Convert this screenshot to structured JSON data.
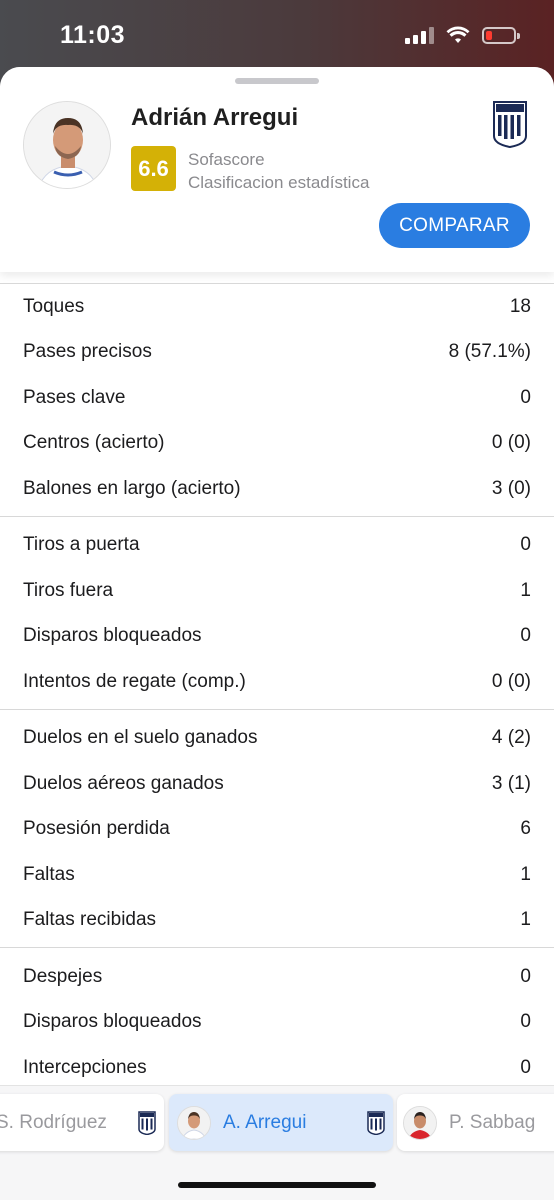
{
  "status_bar": {
    "time": "11:03"
  },
  "player": {
    "name": "Adrián Arregui",
    "rating": "6.6",
    "rating_color": "#d4b106",
    "source_line1": "Sofascore",
    "source_line2": "Clasificacion estadística",
    "compare_label": "COMPARAR",
    "accent": "#2a7de1"
  },
  "stat_groups": [
    [
      {
        "label": "Toques",
        "value": "18"
      },
      {
        "label": "Pases precisos",
        "value": "8 (57.1%)"
      },
      {
        "label": "Pases clave",
        "value": "0"
      },
      {
        "label": "Centros (acierto)",
        "value": "0 (0)"
      },
      {
        "label": "Balones en largo (acierto)",
        "value": "3 (0)"
      }
    ],
    [
      {
        "label": "Tiros a puerta",
        "value": "0"
      },
      {
        "label": "Tiros fuera",
        "value": "1"
      },
      {
        "label": "Disparos bloqueados",
        "value": "0"
      },
      {
        "label": "Intentos de regate (comp.)",
        "value": "0 (0)"
      }
    ],
    [
      {
        "label": "Duelos en el suelo ganados",
        "value": "4 (2)"
      },
      {
        "label": "Duelos aéreos ganados",
        "value": "3 (1)"
      },
      {
        "label": "Posesión perdida",
        "value": "6"
      },
      {
        "label": "Faltas",
        "value": "1"
      },
      {
        "label": "Faltas recibidas",
        "value": "1"
      }
    ],
    [
      {
        "label": "Despejes",
        "value": "0"
      },
      {
        "label": "Disparos bloqueados",
        "value": "0"
      },
      {
        "label": "Intercepciones",
        "value": "0"
      }
    ]
  ],
  "carousel": [
    {
      "name": "S. Rodríguez",
      "active": false
    },
    {
      "name": "A. Arregui",
      "active": true
    },
    {
      "name": "P. Sabbag",
      "active": false
    }
  ]
}
